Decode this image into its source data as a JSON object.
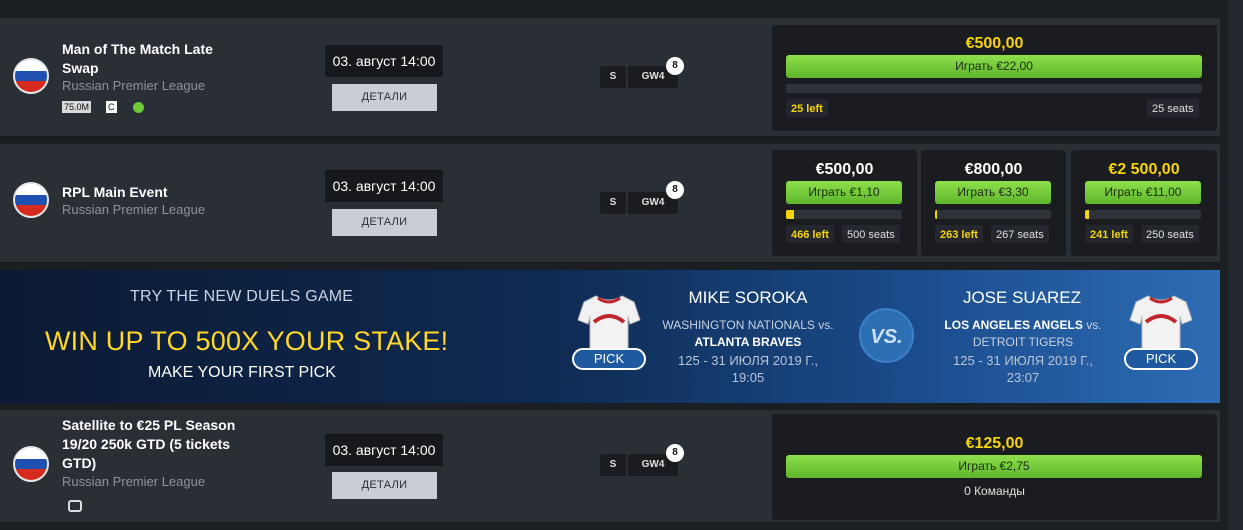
{
  "contests": [
    {
      "title": "Man of The Match Late Swap",
      "league": "Russian Premier League",
      "date": "03. август 14:00",
      "details_label": "ДЕТАЛИ",
      "tag_s": "S",
      "tag_gw": "GW4",
      "badge_count": "8",
      "salary_badge": "75.0M",
      "icon_c": "C",
      "prize": {
        "amount": "€500,00",
        "play_label": "Играть €22,00",
        "left": "25 left",
        "seats": "25 seats",
        "fill_fraction": 0.0
      }
    },
    {
      "title": "RPL Main Event",
      "league": "Russian Premier League",
      "date": "03. август 14:00",
      "details_label": "ДЕТАЛИ",
      "tag_s": "S",
      "tag_gw": "GW4",
      "badge_count": "8",
      "prizes": [
        {
          "amount": "€500,00",
          "play_label": "Играть €1,10",
          "left": "466 left",
          "seats": "500 seats",
          "fill_fraction": 0.07,
          "highlight": false
        },
        {
          "amount": "€800,00",
          "play_label": "Играть €3,30",
          "left": "263 left",
          "seats": "267 seats",
          "fill_fraction": 0.015,
          "highlight": false
        },
        {
          "amount": "€2 500,00",
          "play_label": "Играть €11,00",
          "left": "241 left",
          "seats": "250 seats",
          "fill_fraction": 0.036,
          "highlight": true
        }
      ]
    },
    {
      "title": "Satellite to €25 PL Season 19/20 250k GTD (5 tickets GTD)",
      "league": "Russian Premier League",
      "date": "03. август 14:00",
      "details_label": "ДЕТАЛИ",
      "tag_s": "S",
      "tag_gw": "GW4",
      "badge_count": "8",
      "prize": {
        "amount": "€125,00",
        "play_label": "Играть €2,75",
        "teams_count": "0 Команды"
      }
    }
  ],
  "banner": {
    "try_text": "TRY THE NEW DUELS GAME",
    "win_text": "WIN UP TO 500X YOUR STAKE!",
    "make_text": "MAKE YOUR FIRST PICK",
    "vs_text": "VS.",
    "left_player": {
      "name": "MIKE SOROKA",
      "team1": "WASHINGTON NATIONALS",
      "vs_small": "vs.",
      "team2": "ATLANTA BRAVES",
      "dates": "125 - 31 ИЮЛЯ 2019 Г.,",
      "time": "19:05",
      "pick_label": "PICK"
    },
    "right_player": {
      "name": "JOSE SUAREZ",
      "team1": "LOS ANGELES ANGELS",
      "vs_small": "vs.",
      "team2": "DETROIT TIGERS",
      "dates": "125 - 31 ИЮЛЯ 2019 Г.,",
      "time": "23:07",
      "pick_label": "PICK"
    }
  },
  "colors": {
    "accent_green": "#6fc83a",
    "yellow": "#f6d40a",
    "banner_blue": "#2e6cb4"
  }
}
